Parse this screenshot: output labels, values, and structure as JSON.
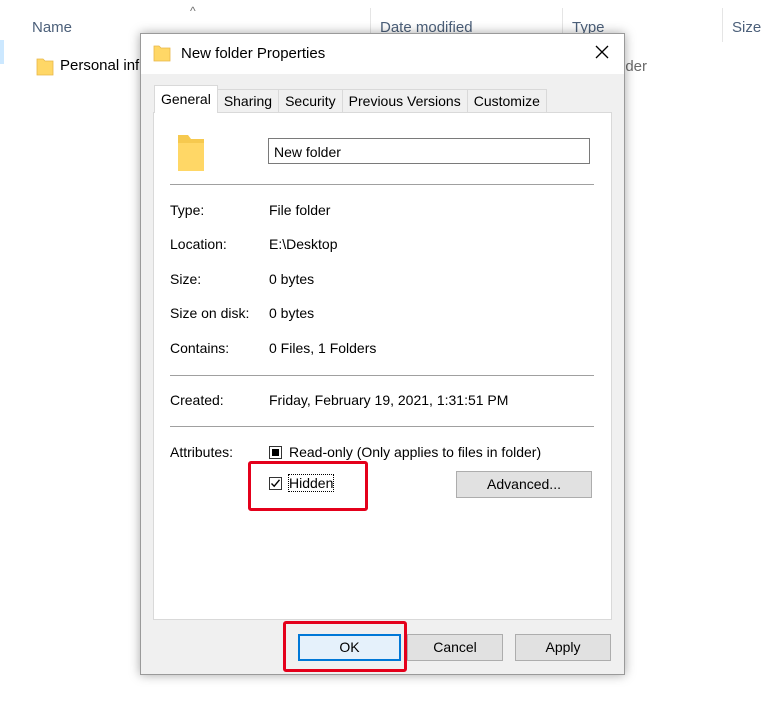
{
  "explorer": {
    "columns": {
      "name": "Name",
      "date_modified": "Date modified",
      "type": "Type",
      "size": "Size"
    },
    "row": {
      "name": "Personal inf",
      "type_tail": "lder"
    }
  },
  "dialog": {
    "title": "New folder Properties",
    "tabs": [
      "General",
      "Sharing",
      "Security",
      "Previous Versions",
      "Customize"
    ],
    "active_tab": "General",
    "folder_name": "New folder",
    "info": {
      "type_label": "Type:",
      "type_value": "File folder",
      "location_label": "Location:",
      "location_value": "E:\\Desktop",
      "size_label": "Size:",
      "size_value": "0 bytes",
      "size_on_disk_label": "Size on disk:",
      "size_on_disk_value": "0 bytes",
      "contains_label": "Contains:",
      "contains_value": "0 Files, 1 Folders",
      "created_label": "Created:",
      "created_value": "Friday, February 19, 2021, 1:31:51 PM"
    },
    "attributes": {
      "label": "Attributes:",
      "readonly_label": "Read-only (Only applies to files in folder)",
      "readonly_state": "indeterminate",
      "hidden_label": "Hidden",
      "hidden_state": "checked",
      "advanced_label": "Advanced..."
    },
    "buttons": {
      "ok": "OK",
      "cancel": "Cancel",
      "apply": "Apply"
    },
    "colors": {
      "highlight": "#e4001b",
      "accent": "#0078d7",
      "folder": "#ffd766"
    }
  }
}
